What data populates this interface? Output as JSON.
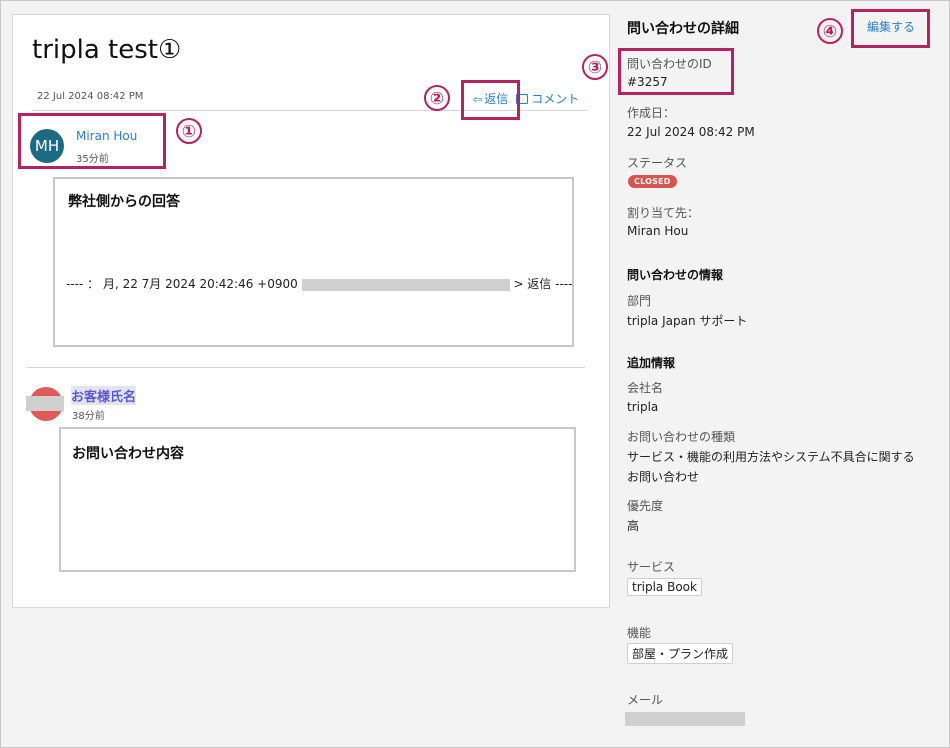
{
  "ticket": {
    "title": "tripla test①",
    "date": "22 Jul 2024 08:42 PM",
    "reply_label": "返信",
    "comment_label": "コメント"
  },
  "messages": [
    {
      "avatar_initials": "MH",
      "avatar_color": "#1b6b85",
      "author": "Miran Hou",
      "ago": "35分前",
      "body_title": "弊社側からの回答",
      "quote_prefix": "---- ： 月, 22 7月 2024 20:42:46 +0900",
      "quote_suffix": "> 返信 ----"
    },
    {
      "avatar_color": "#e05a5a",
      "author": "お客様氏名",
      "ago": "38分前",
      "body_title": "お問い合わせ内容"
    }
  ],
  "annotations": [
    "①",
    "②",
    "③",
    "④"
  ],
  "sidebar": {
    "heading": "問い合わせの詳細",
    "edit_label": "編集する",
    "id_label": "問い合わせのID",
    "id_value": "#3257",
    "created_label": "作成日：",
    "created_value": "22 Jul 2024 08:42 PM",
    "status_label": "ステータス",
    "status_value": "CLOSED",
    "status_color": "#d9534f",
    "assignee_label": "割り当て先：",
    "assignee_value": "Miran Hou",
    "info_heading": "問い合わせの情報",
    "dept_label": "部門",
    "dept_value": "tripla Japan サポート",
    "extra_heading": "追加情報",
    "company_label": "会社名",
    "company_value": "tripla",
    "type_label": "お問い合わせの種類",
    "type_value_line1": "サービス・機能の利用方法やシステム不具合に関する",
    "type_value_line2": "お問い合わせ",
    "priority_label": "優先度",
    "priority_value": "高",
    "service_label": "サービス",
    "service_value": "tripla Book",
    "feature_label": "機能",
    "feature_value": "部屋・プラン作成",
    "mail_label": "メール"
  },
  "colors": {
    "link": "#2a7fd4",
    "annotation": "#b5245f"
  }
}
